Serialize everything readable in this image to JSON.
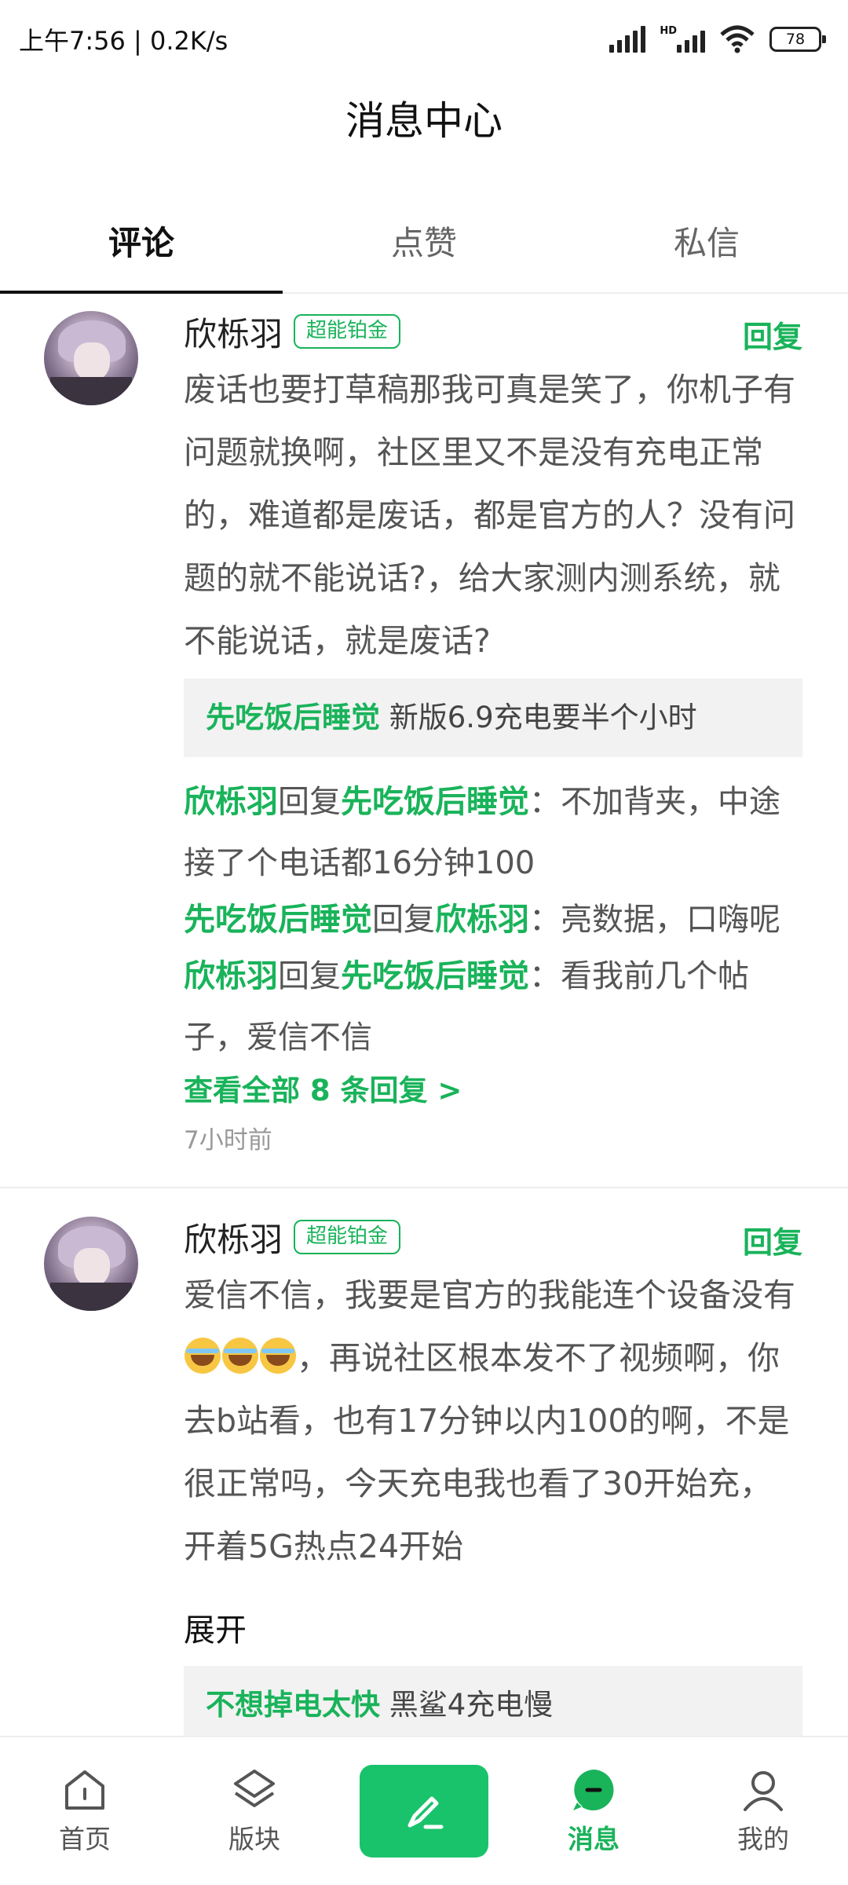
{
  "status_bar": {
    "time": "上午7:56",
    "speed": "0.2K/s",
    "battery": "78"
  },
  "header": {
    "title": "消息中心"
  },
  "tabs": [
    {
      "label": "评论",
      "active": true
    },
    {
      "label": "点赞",
      "active": false
    },
    {
      "label": "私信",
      "active": false
    }
  ],
  "comments": [
    {
      "username": "欣栎羽",
      "badge": "超能铂金",
      "reply_label": "回复",
      "content": "废话也要打草稿那我可真是笑了，你机子有问题就换啊，社区里又不是没有充电正常的，难道都是废话，都是官方的人？没有问题的就不能说话?，给大家测内测系统，就不能说话，就是废话?",
      "quote": {
        "author": "先吃饭后睡觉",
        "text": "新版6.9充电要半个小时"
      },
      "sub_replies": [
        {
          "from": "欣栎羽",
          "verb": "回复",
          "to": "先吃饭后睡觉",
          "text": "：不加背夹，中途接了个电话都16分钟100"
        },
        {
          "from": "先吃饭后睡觉",
          "verb": "回复",
          "to": "欣栎羽",
          "text": "：亮数据，口嗨呢"
        },
        {
          "from": "欣栎羽",
          "verb": "回复",
          "to": "先吃饭后睡觉",
          "text": "：看我前几个帖子，爱信不信"
        }
      ],
      "view_all": "查看全部 8 条回复 >",
      "time": "7小时前"
    },
    {
      "username": "欣栎羽",
      "badge": "超能铂金",
      "reply_label": "回复",
      "content_before": "爱信不信，我要是官方的我能连个设备没有",
      "content_after": "，再说社区根本发不了视频啊，你去b站看，也有17分钟以内100的啊，不是很正常吗，今天充电我也看了30开始充，开着5G热点24开始",
      "expand": "展开",
      "quote": {
        "author": "不想掉电太快",
        "text": "黑鲨4充电慢"
      }
    }
  ],
  "bottom_nav": [
    {
      "label": "首页",
      "icon": "home-icon",
      "active": false
    },
    {
      "label": "版块",
      "icon": "layers-icon",
      "active": false
    },
    {
      "label": "",
      "icon": "compose-icon",
      "active": false
    },
    {
      "label": "消息",
      "icon": "message-icon",
      "active": true
    },
    {
      "label": "我的",
      "icon": "profile-icon",
      "active": false
    }
  ],
  "colors": {
    "accent": "#19b35a",
    "post_button": "#19c36b"
  }
}
